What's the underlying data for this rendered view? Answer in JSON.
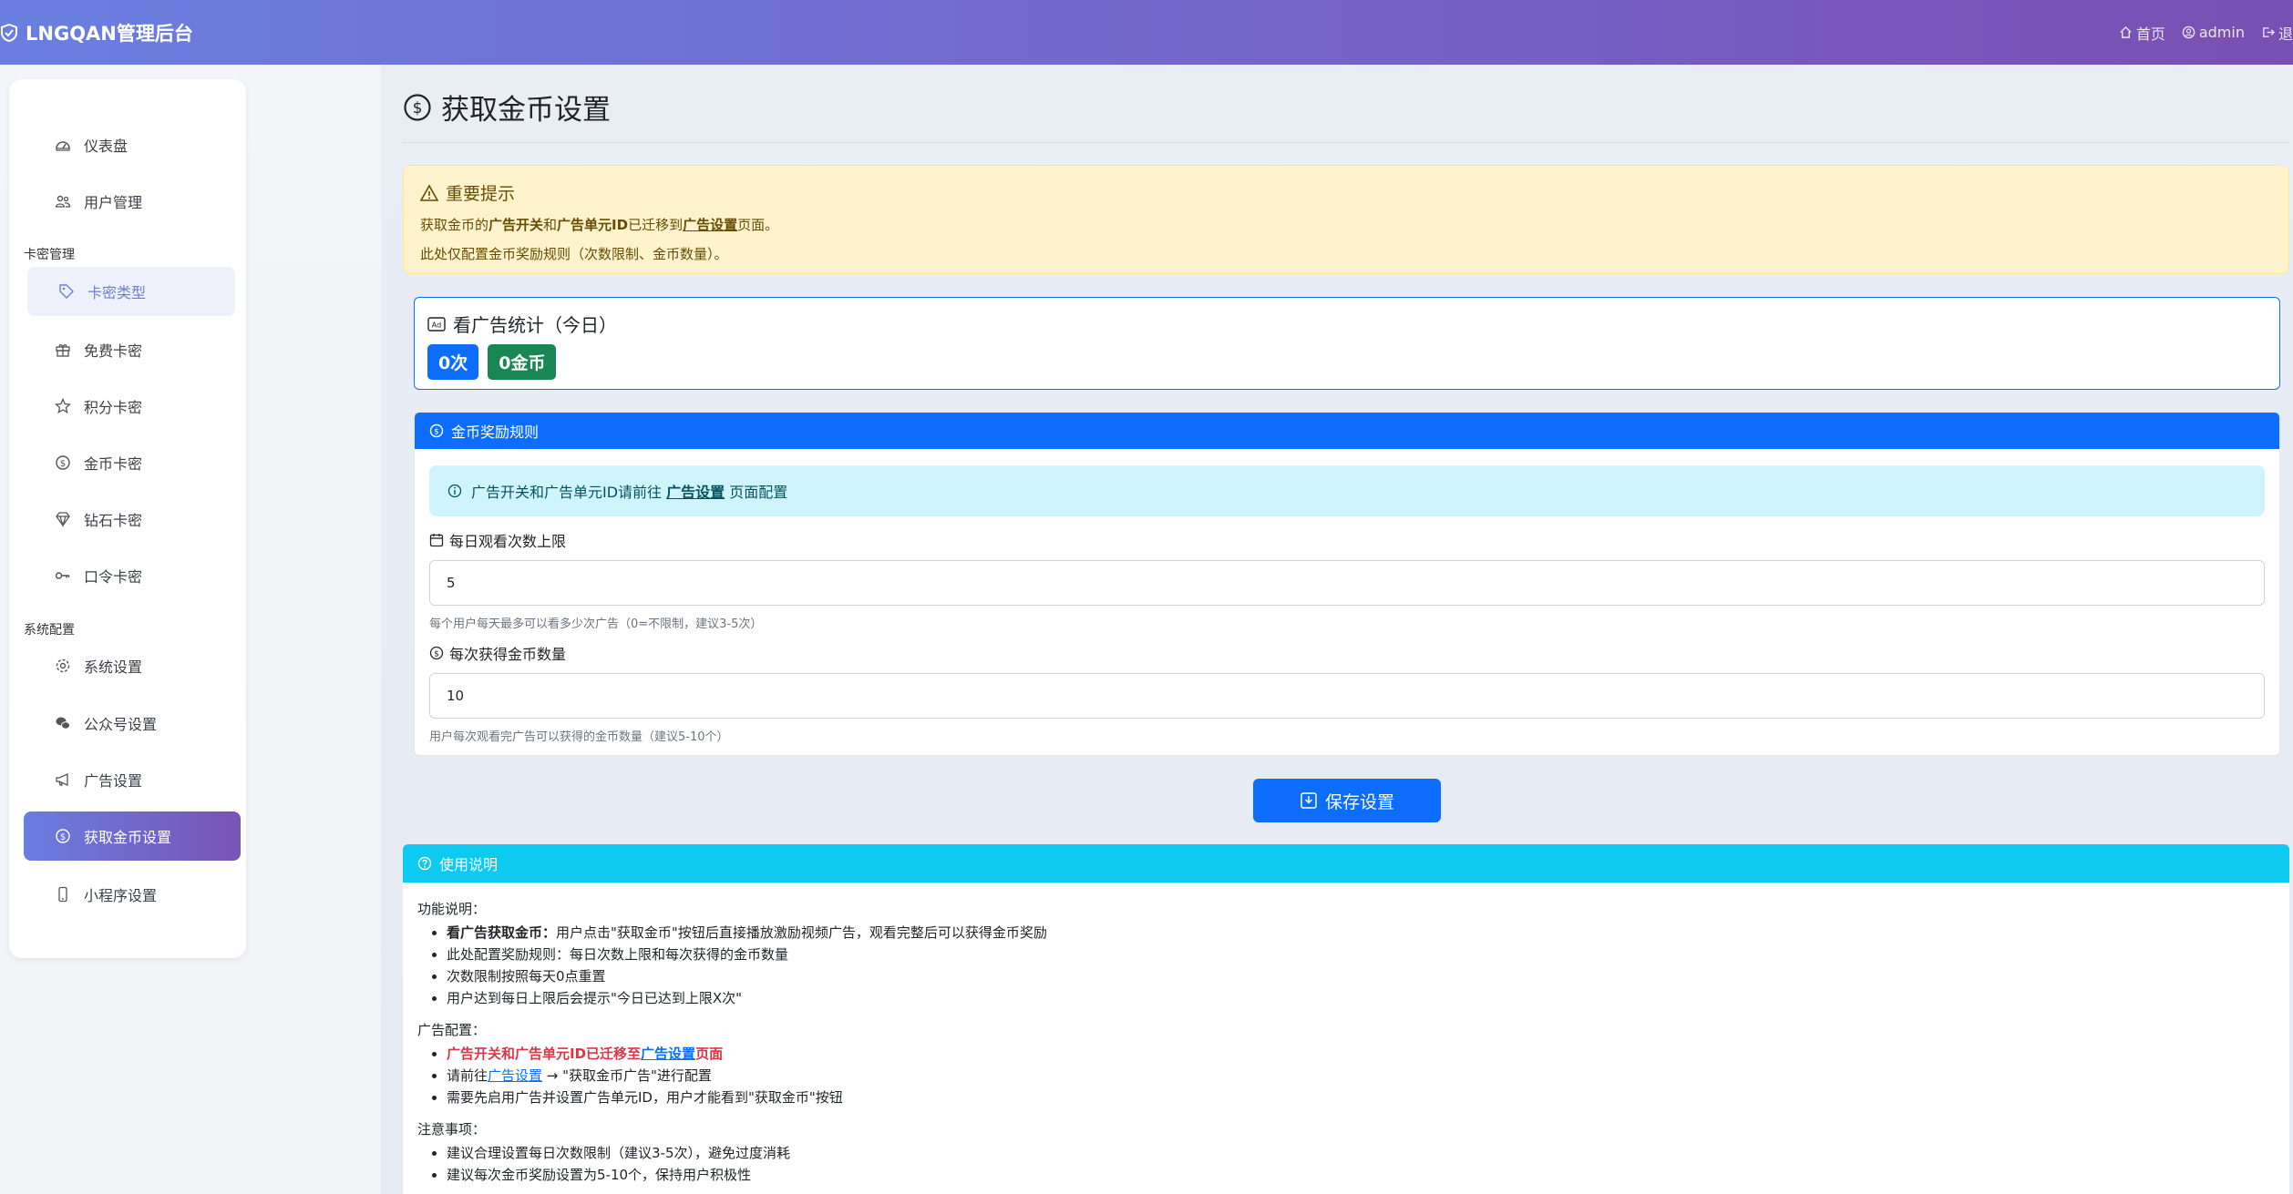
{
  "header": {
    "brand": "LNGQAN管理后台",
    "nav": [
      {
        "label": "首页",
        "icon": "home-icon"
      },
      {
        "label": "admin",
        "icon": "user-circle-icon"
      },
      {
        "label": "退",
        "icon": "logout-icon"
      }
    ]
  },
  "sidebar": {
    "items": [
      {
        "label": "仪表盘",
        "icon": "dashboard-icon"
      },
      {
        "label": "用户管理",
        "icon": "users-icon"
      },
      {
        "label": "卡密类型",
        "icon": "tag-icon"
      },
      {
        "label": "免费卡密",
        "icon": "gift-icon"
      },
      {
        "label": "积分卡密",
        "icon": "star-icon"
      },
      {
        "label": "金币卡密",
        "icon": "coin-icon"
      },
      {
        "label": "钻石卡密",
        "icon": "gem-icon"
      },
      {
        "label": "口令卡密",
        "icon": "key-icon"
      },
      {
        "label": "系统设置",
        "icon": "gear-icon"
      },
      {
        "label": "公众号设置",
        "icon": "wechat-icon"
      },
      {
        "label": "广告设置",
        "icon": "megaphone-icon"
      },
      {
        "label": "获取金币设置",
        "icon": "coin-icon"
      },
      {
        "label": "小程序设置",
        "icon": "phone-icon"
      }
    ],
    "sections": [
      "卡密管理",
      "系统配置"
    ]
  },
  "page": {
    "title": "获取金币设置"
  },
  "warning": {
    "title": "重要提示",
    "line1_a": "获取金币的",
    "line1_b": "广告开关",
    "line1_c": "和",
    "line1_d": "广告单元ID",
    "line1_e": "已迁移到",
    "line1_f": "广告设置",
    "line1_g": "页面。",
    "line2": "此处仅配置金币奖励规则（次数限制、金币数量）。"
  },
  "stats": {
    "title": "看广告统计（今日）",
    "count": "0次",
    "coins": "0金币"
  },
  "rules": {
    "header": "金币奖励规则",
    "info_a": "广告开关和广告单元ID请前往",
    "info_link": "广告设置",
    "info_b": "页面配置",
    "daily_label": "每日观看次数上限",
    "daily_value": "5",
    "daily_help": "每个用户每天最多可以看多少次广告（0=不限制，建议3-5次）",
    "coins_label": "每次获得金币数量",
    "coins_value": "10",
    "coins_help": "用户每次观看完广告可以获得的金币数量（建议5-10个）"
  },
  "save_label": "保存设置",
  "usage": {
    "header": "使用说明",
    "sec1_title": "功能说明：",
    "sec1_item1_bold": "看广告获取金币：",
    "sec1_item1_rest": "用户点击\"获取金币\"按钮后直接播放激励视频广告，观看完整后可以获得金币奖励",
    "sec1_item2": "此处配置奖励规则：每日次数上限和每次获得的金币数量",
    "sec1_item3": "次数限制按照每天0点重置",
    "sec1_item4": "用户达到每日上限后会提示\"今日已达到上限X次\"",
    "sec2_title": "广告配置：",
    "sec2_item1_a": "广告开关和广告单元ID已迁移至",
    "sec2_item1_link": "广告设置",
    "sec2_item1_b": "页面",
    "sec2_item2_a": "请前往",
    "sec2_item2_link": "广告设置",
    "sec2_item2_b": " → \"获取金币广告\"进行配置",
    "sec2_item3": "需要先启用广告并设置广告单元ID，用户才能看到\"获取金币\"按钮",
    "sec3_title": "注意事项：",
    "sec3_item1": "建议合理设置每日次数限制（建议3-5次），避免过度消耗",
    "sec3_item2": "建议每次金币奖励设置为5-10个，保持用户积极性"
  },
  "colors": {
    "primary": "#0d6efd",
    "success": "#198754",
    "info": "#0dcaf0",
    "warning_bg": "#fff3cd",
    "danger": "#dc3545",
    "header_start": "#6a7fe0",
    "header_end": "#7a4fb3"
  }
}
